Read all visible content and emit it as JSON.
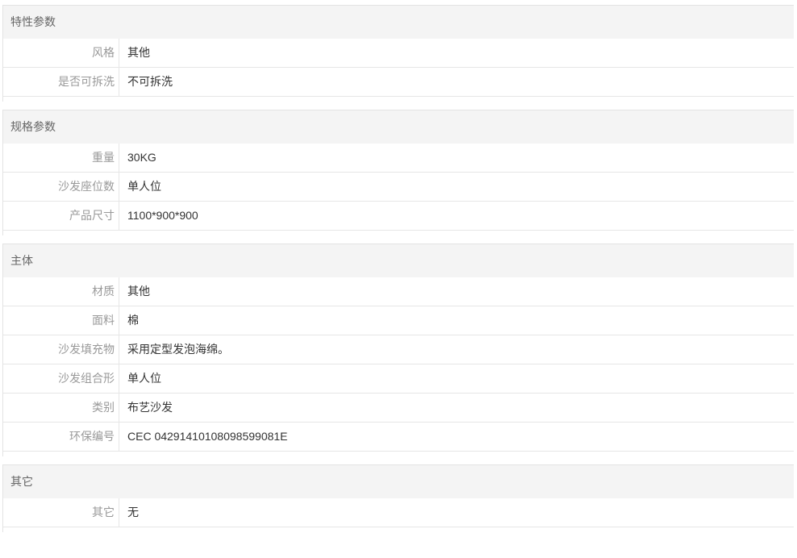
{
  "sections": [
    {
      "title": "特性参数",
      "rows": [
        {
          "label": "风格",
          "value": "其他"
        },
        {
          "label": "是否可拆洗",
          "value": "不可拆洗"
        }
      ]
    },
    {
      "title": "规格参数",
      "rows": [
        {
          "label": "重量",
          "value": "30KG"
        },
        {
          "label": "沙发座位数",
          "value": "单人位"
        },
        {
          "label": "产品尺寸",
          "value": "1100*900*900"
        }
      ]
    },
    {
      "title": "主体",
      "rows": [
        {
          "label": "材质",
          "value": "其他"
        },
        {
          "label": "面料",
          "value": "棉"
        },
        {
          "label": "沙发填充物",
          "value": "采用定型发泡海绵。"
        },
        {
          "label": "沙发组合形",
          "value": "单人位"
        },
        {
          "label": "类别",
          "value": "布艺沙发"
        },
        {
          "label": "环保编号",
          "value": "CEC 04291410108098599081E"
        }
      ]
    },
    {
      "title": "其它",
      "rows": [
        {
          "label": "其它",
          "value": "无"
        }
      ]
    }
  ]
}
